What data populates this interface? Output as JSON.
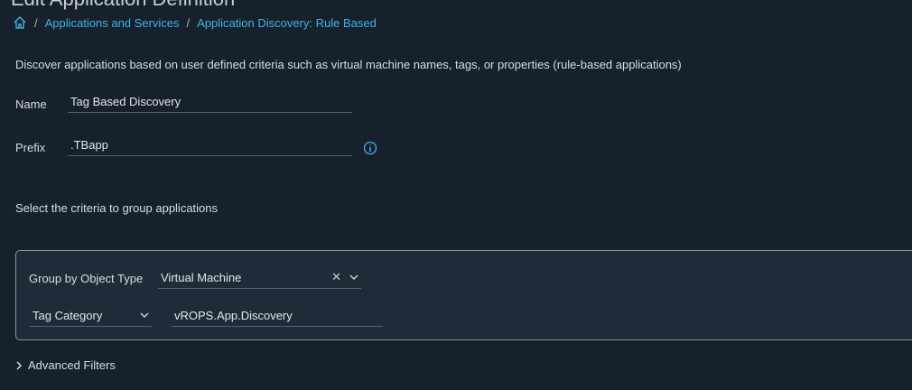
{
  "page_title": "Edit Application Definition",
  "breadcrumb": {
    "items": [
      "Applications and Services",
      "Application Discovery: Rule Based"
    ]
  },
  "description": "Discover applications based on user defined criteria such as virtual machine names, tags, or properties (rule-based applications)",
  "form": {
    "name_label": "Name",
    "name_value": "Tag Based Discovery",
    "prefix_label": "Prefix",
    "prefix_value": ".TBapp"
  },
  "criteria_label": "Select the criteria to group applications",
  "group": {
    "object_type_label": "Group by Object Type",
    "object_type_value": "Virtual Machine",
    "category_select": "Tag Category",
    "category_value": "vROPS.App.Discovery"
  },
  "advanced_filters": "Advanced Filters"
}
